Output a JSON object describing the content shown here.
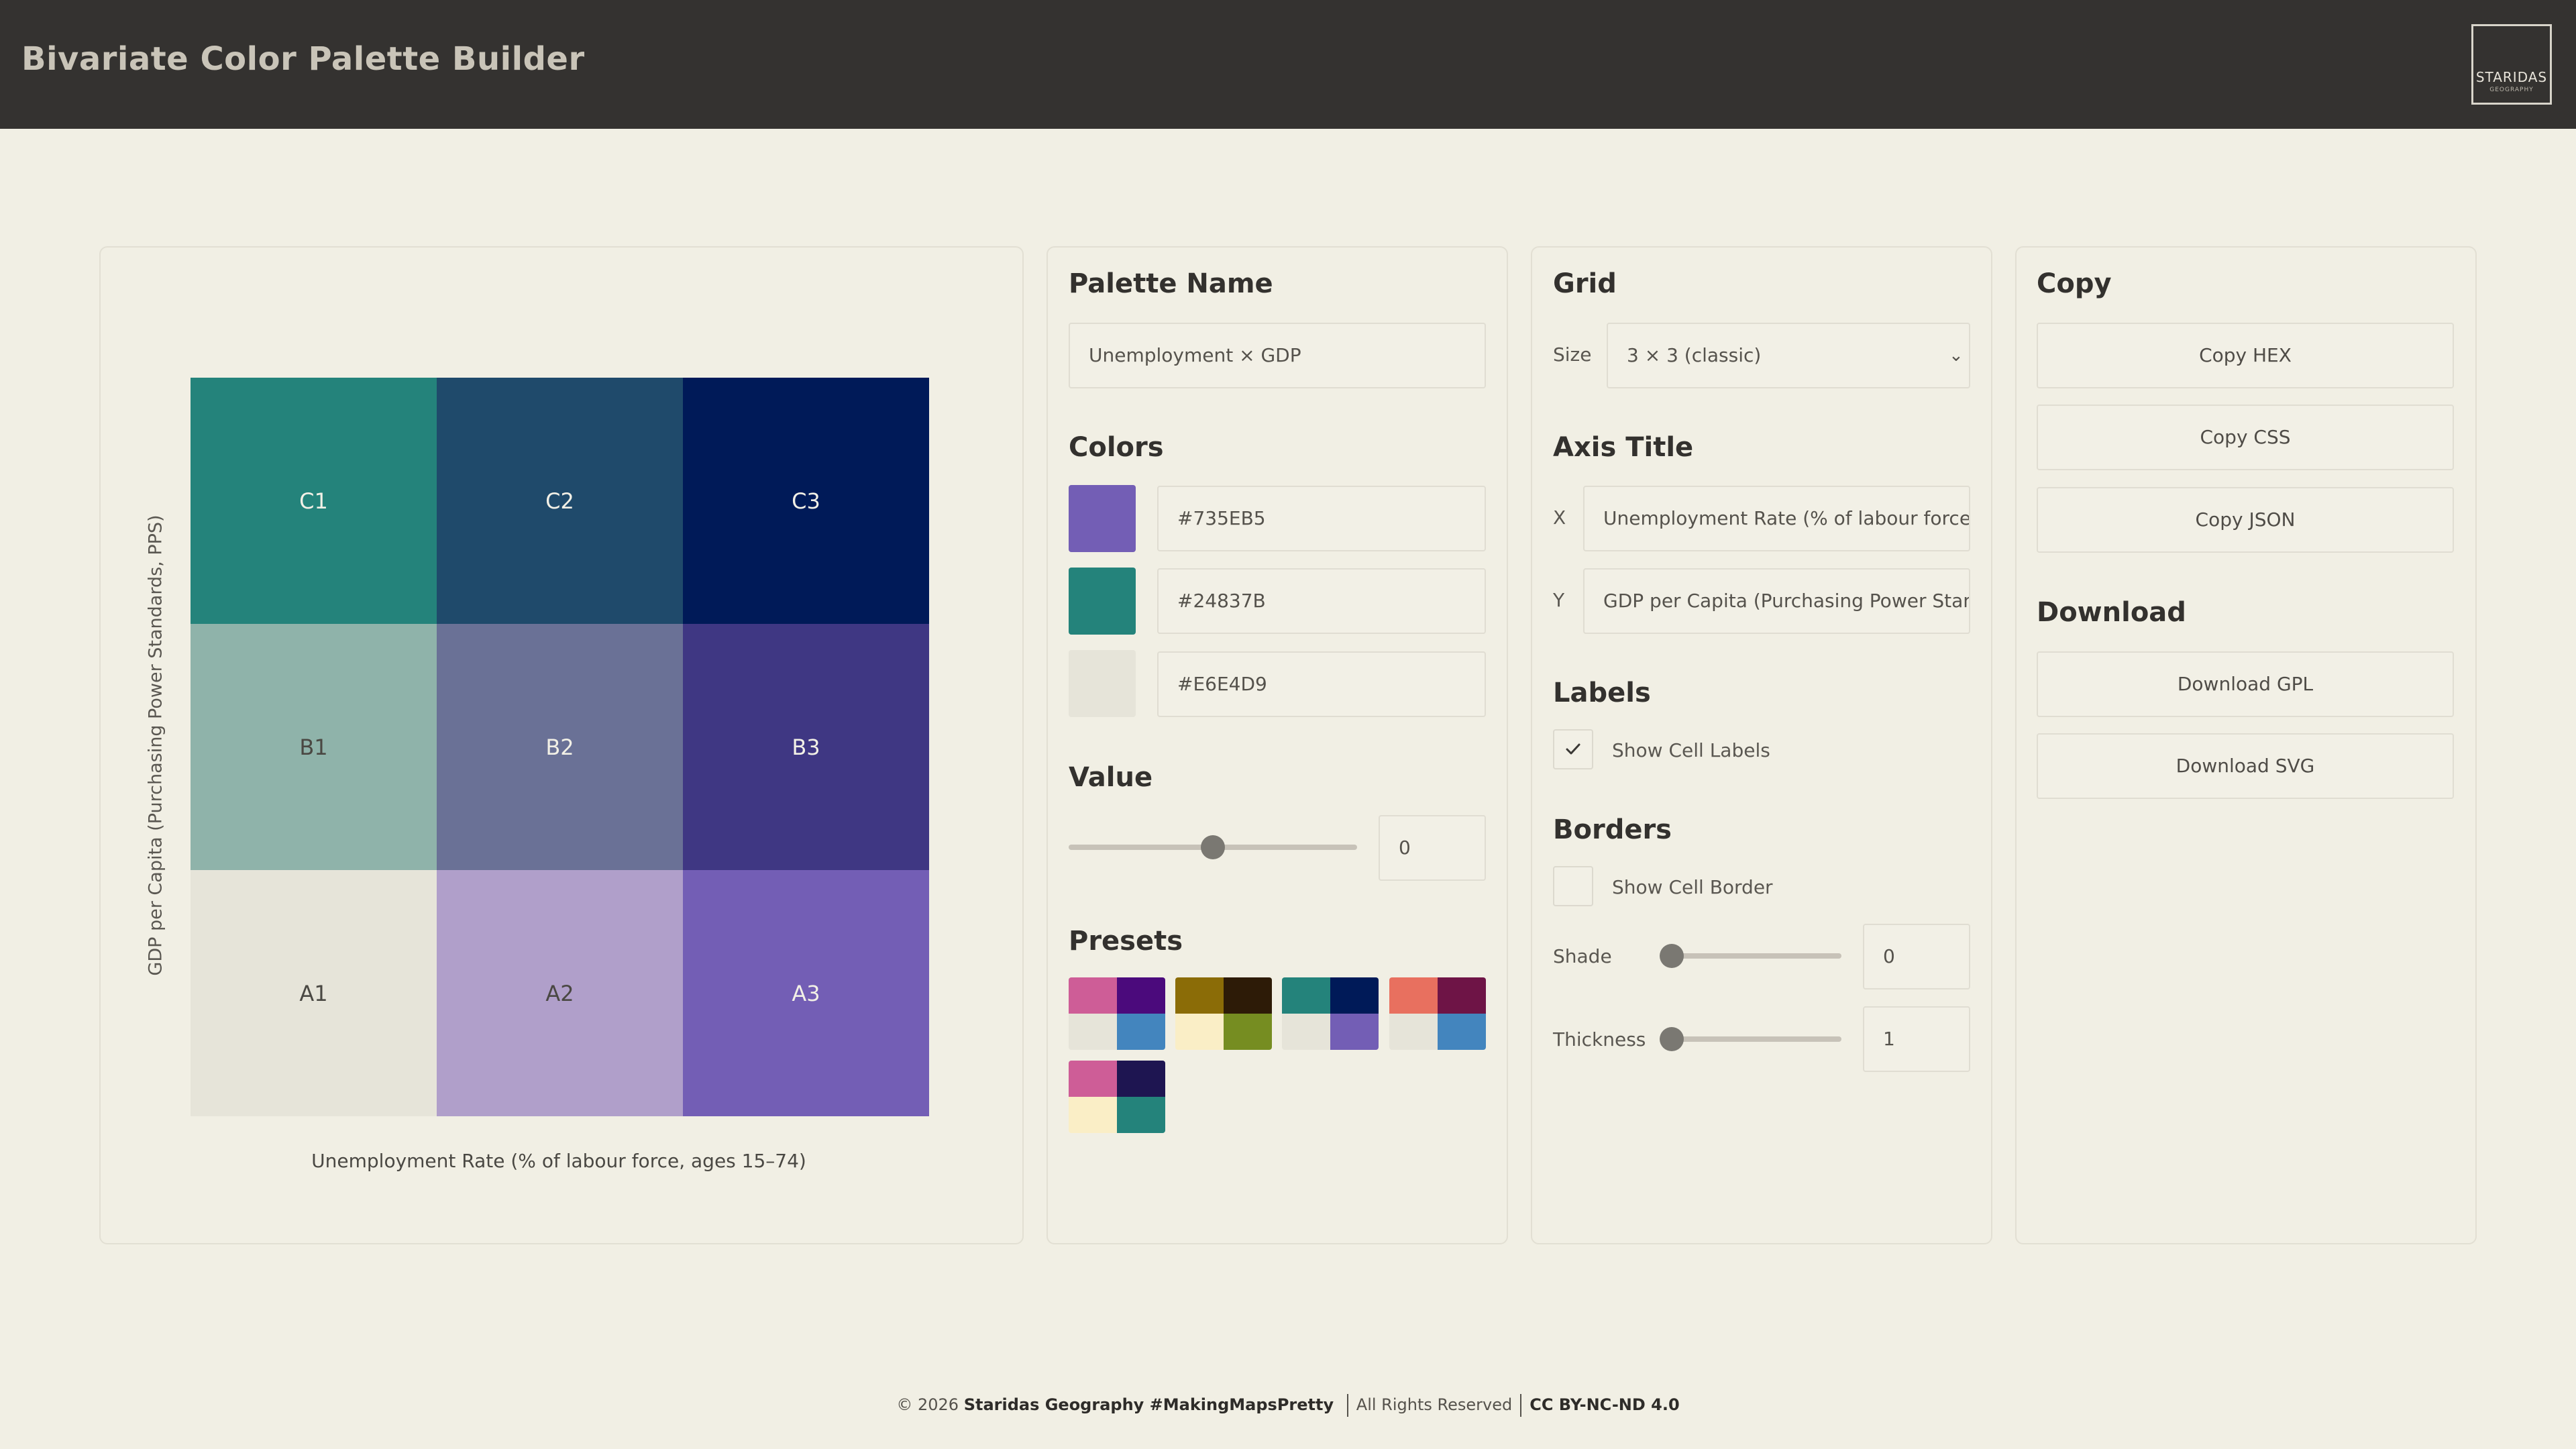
{
  "header": {
    "title": "Bivariate Color Palette Builder",
    "logo_text": "STARIDAS",
    "logo_subtext": "GEOGRAPHY"
  },
  "preview": {
    "cells": [
      "C1",
      "C2",
      "C3",
      "B1",
      "B2",
      "B3",
      "A1",
      "A2",
      "A3"
    ],
    "cell_colors": [
      "#24837B",
      "#1F4A6B",
      "#001A58",
      "#8FB3AA",
      "#6A7196",
      "#3F3783",
      "#E6E4D9",
      "#B09FCA",
      "#735EB5"
    ],
    "x_axis_label": "Unemployment Rate (% of labour force, ages 15–74)",
    "y_axis_label": "GDP per Capita (Purchasing Power Standards, PPS)"
  },
  "palette": {
    "name_title": "Palette Name",
    "name_value": "Unemployment × GDP",
    "colors_title": "Colors",
    "colors": [
      "#735EB5",
      "#24837B",
      "#E6E4D9"
    ],
    "value_title": "Value",
    "value": "0",
    "value_slider_fraction": 0.5,
    "presets_title": "Presets",
    "presets": [
      [
        "#CE5D97",
        "#4B0A7C",
        "#E6E4D9",
        "#4385BE"
      ],
      [
        "#8B6C07",
        "#2D1B07",
        "#FAEEC6",
        "#768D21"
      ],
      [
        "#24837B",
        "#001A58",
        "#E6E4D9",
        "#735EB5"
      ],
      [
        "#E8705F",
        "#6E1446",
        "#E6E4D9",
        "#4385BE"
      ],
      [
        "#CE5D97",
        "#1E1551",
        "#FAEEC6",
        "#24837B"
      ]
    ]
  },
  "grid": {
    "title": "Grid",
    "size_label": "Size",
    "size_value": "3 × 3 (classic)",
    "axis_title": "Axis Title",
    "x_label": "X",
    "x_value": "Unemployment Rate (% of labour force,",
    "y_label": "Y",
    "y_value": "GDP per Capita (Purchasing Power Stand",
    "labels_title": "Labels",
    "show_cell_labels": "Show Cell Labels",
    "show_cell_labels_checked": true,
    "borders_title": "Borders",
    "show_cell_border": "Show Cell Border",
    "show_cell_border_checked": false,
    "shade_label": "Shade",
    "shade_value": "0",
    "thickness_label": "Thickness",
    "thickness_value": "1"
  },
  "copy": {
    "title": "Copy",
    "copy_hex": "Copy HEX",
    "copy_css": "Copy CSS",
    "copy_json": "Copy JSON",
    "download_title": "Download",
    "download_gpl": "Download GPL",
    "download_svg": "Download SVG"
  },
  "footer": {
    "copyright": "© 2026",
    "brand": "Staridas Geography #MakingMapsPretty",
    "rights": "All Rights Reserved",
    "license": "CC BY-NC-ND 4.0"
  }
}
